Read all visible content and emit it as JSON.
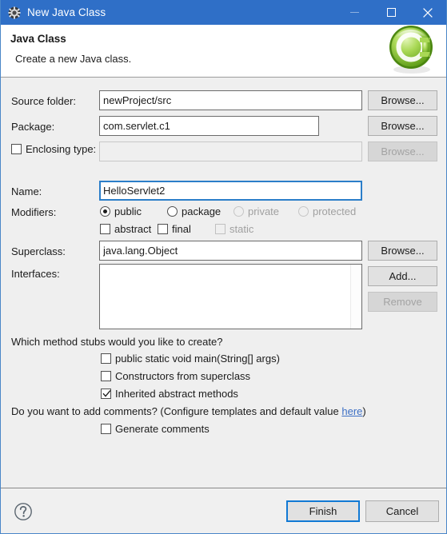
{
  "window": {
    "title": "New Java Class",
    "icon": "java-class-gear-icon",
    "titlebar_color": "#2f6fc7",
    "controls": {
      "minimize": "minimize-icon",
      "maximize": "maximize-icon",
      "close": "close-icon"
    }
  },
  "header": {
    "title": "Java Class",
    "subtitle": "Create a new Java class.",
    "banner_icon": "green-class-c-icon",
    "banner_color": "#8cc63f"
  },
  "form": {
    "source_folder": {
      "label": "Source folder:",
      "value": "newProject/src",
      "browse": "Browse..."
    },
    "package": {
      "label": "Package:",
      "value": "com.servlet.c1",
      "browse": "Browse..."
    },
    "enclosing_type": {
      "label": "Enclosing type:",
      "checked": false,
      "value": "",
      "browse": "Browse...",
      "enabled": false
    },
    "name": {
      "label": "Name:",
      "value": "HelloServlet2",
      "focused": true
    },
    "modifiers": {
      "label": "Modifiers:",
      "radios": [
        {
          "label": "public",
          "selected": true,
          "enabled": true
        },
        {
          "label": "package",
          "selected": false,
          "enabled": true
        },
        {
          "label": "private",
          "selected": false,
          "enabled": false
        },
        {
          "label": "protected",
          "selected": false,
          "enabled": false
        }
      ],
      "checks": [
        {
          "label": "abstract",
          "checked": false,
          "enabled": true
        },
        {
          "label": "final",
          "checked": false,
          "enabled": true
        },
        {
          "label": "static",
          "checked": false,
          "enabled": false
        }
      ]
    },
    "superclass": {
      "label": "Superclass:",
      "value": "java.lang.Object",
      "browse": "Browse..."
    },
    "interfaces": {
      "label": "Interfaces:",
      "items": [],
      "add": "Add...",
      "remove": "Remove",
      "remove_enabled": false
    }
  },
  "stubs": {
    "question": "Which method stubs would you like to create?",
    "options": [
      {
        "label": "public static void main(String[] args)",
        "checked": false
      },
      {
        "label": "Constructors from superclass",
        "checked": false
      },
      {
        "label": "Inherited abstract methods",
        "checked": true
      }
    ]
  },
  "comments": {
    "question_prefix": "Do you want to add comments? (Configure templates and default value ",
    "link": "here",
    "question_suffix": ")",
    "option": {
      "label": "Generate comments",
      "checked": false
    }
  },
  "footer": {
    "help_icon": "help-question-icon",
    "finish": "Finish",
    "cancel": "Cancel",
    "default_border_color": "#1179d4"
  }
}
